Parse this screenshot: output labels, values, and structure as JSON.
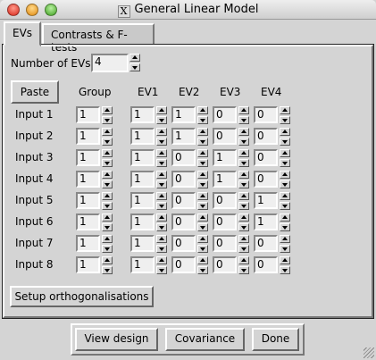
{
  "window": {
    "title": "General Linear Model"
  },
  "tabs": [
    {
      "label": "EVs",
      "active": true
    },
    {
      "label": "Contrasts & F-tests",
      "active": false
    }
  ],
  "num_evs": {
    "label": "Number of EVs",
    "value": "4"
  },
  "paste_label": "Paste",
  "headers": {
    "group": "Group",
    "ev": [
      "EV1",
      "EV2",
      "EV3",
      "EV4"
    ]
  },
  "rows": [
    {
      "label": "Input 1",
      "group": "1",
      "ev": [
        "1",
        "1",
        "0",
        "0"
      ]
    },
    {
      "label": "Input 2",
      "group": "1",
      "ev": [
        "1",
        "1",
        "0",
        "0"
      ]
    },
    {
      "label": "Input 3",
      "group": "1",
      "ev": [
        "1",
        "0",
        "1",
        "0"
      ]
    },
    {
      "label": "Input 4",
      "group": "1",
      "ev": [
        "1",
        "0",
        "1",
        "0"
      ]
    },
    {
      "label": "Input 5",
      "group": "1",
      "ev": [
        "1",
        "0",
        "0",
        "1"
      ]
    },
    {
      "label": "Input 6",
      "group": "1",
      "ev": [
        "1",
        "0",
        "0",
        "1"
      ]
    },
    {
      "label": "Input 7",
      "group": "1",
      "ev": [
        "1",
        "0",
        "0",
        "0"
      ]
    },
    {
      "label": "Input 8",
      "group": "1",
      "ev": [
        "1",
        "0",
        "0",
        "0"
      ]
    }
  ],
  "setup_orth_label": "Setup orthogonalisations",
  "footer": {
    "view_design": "View design",
    "covariance": "Covariance",
    "done": "Done"
  }
}
